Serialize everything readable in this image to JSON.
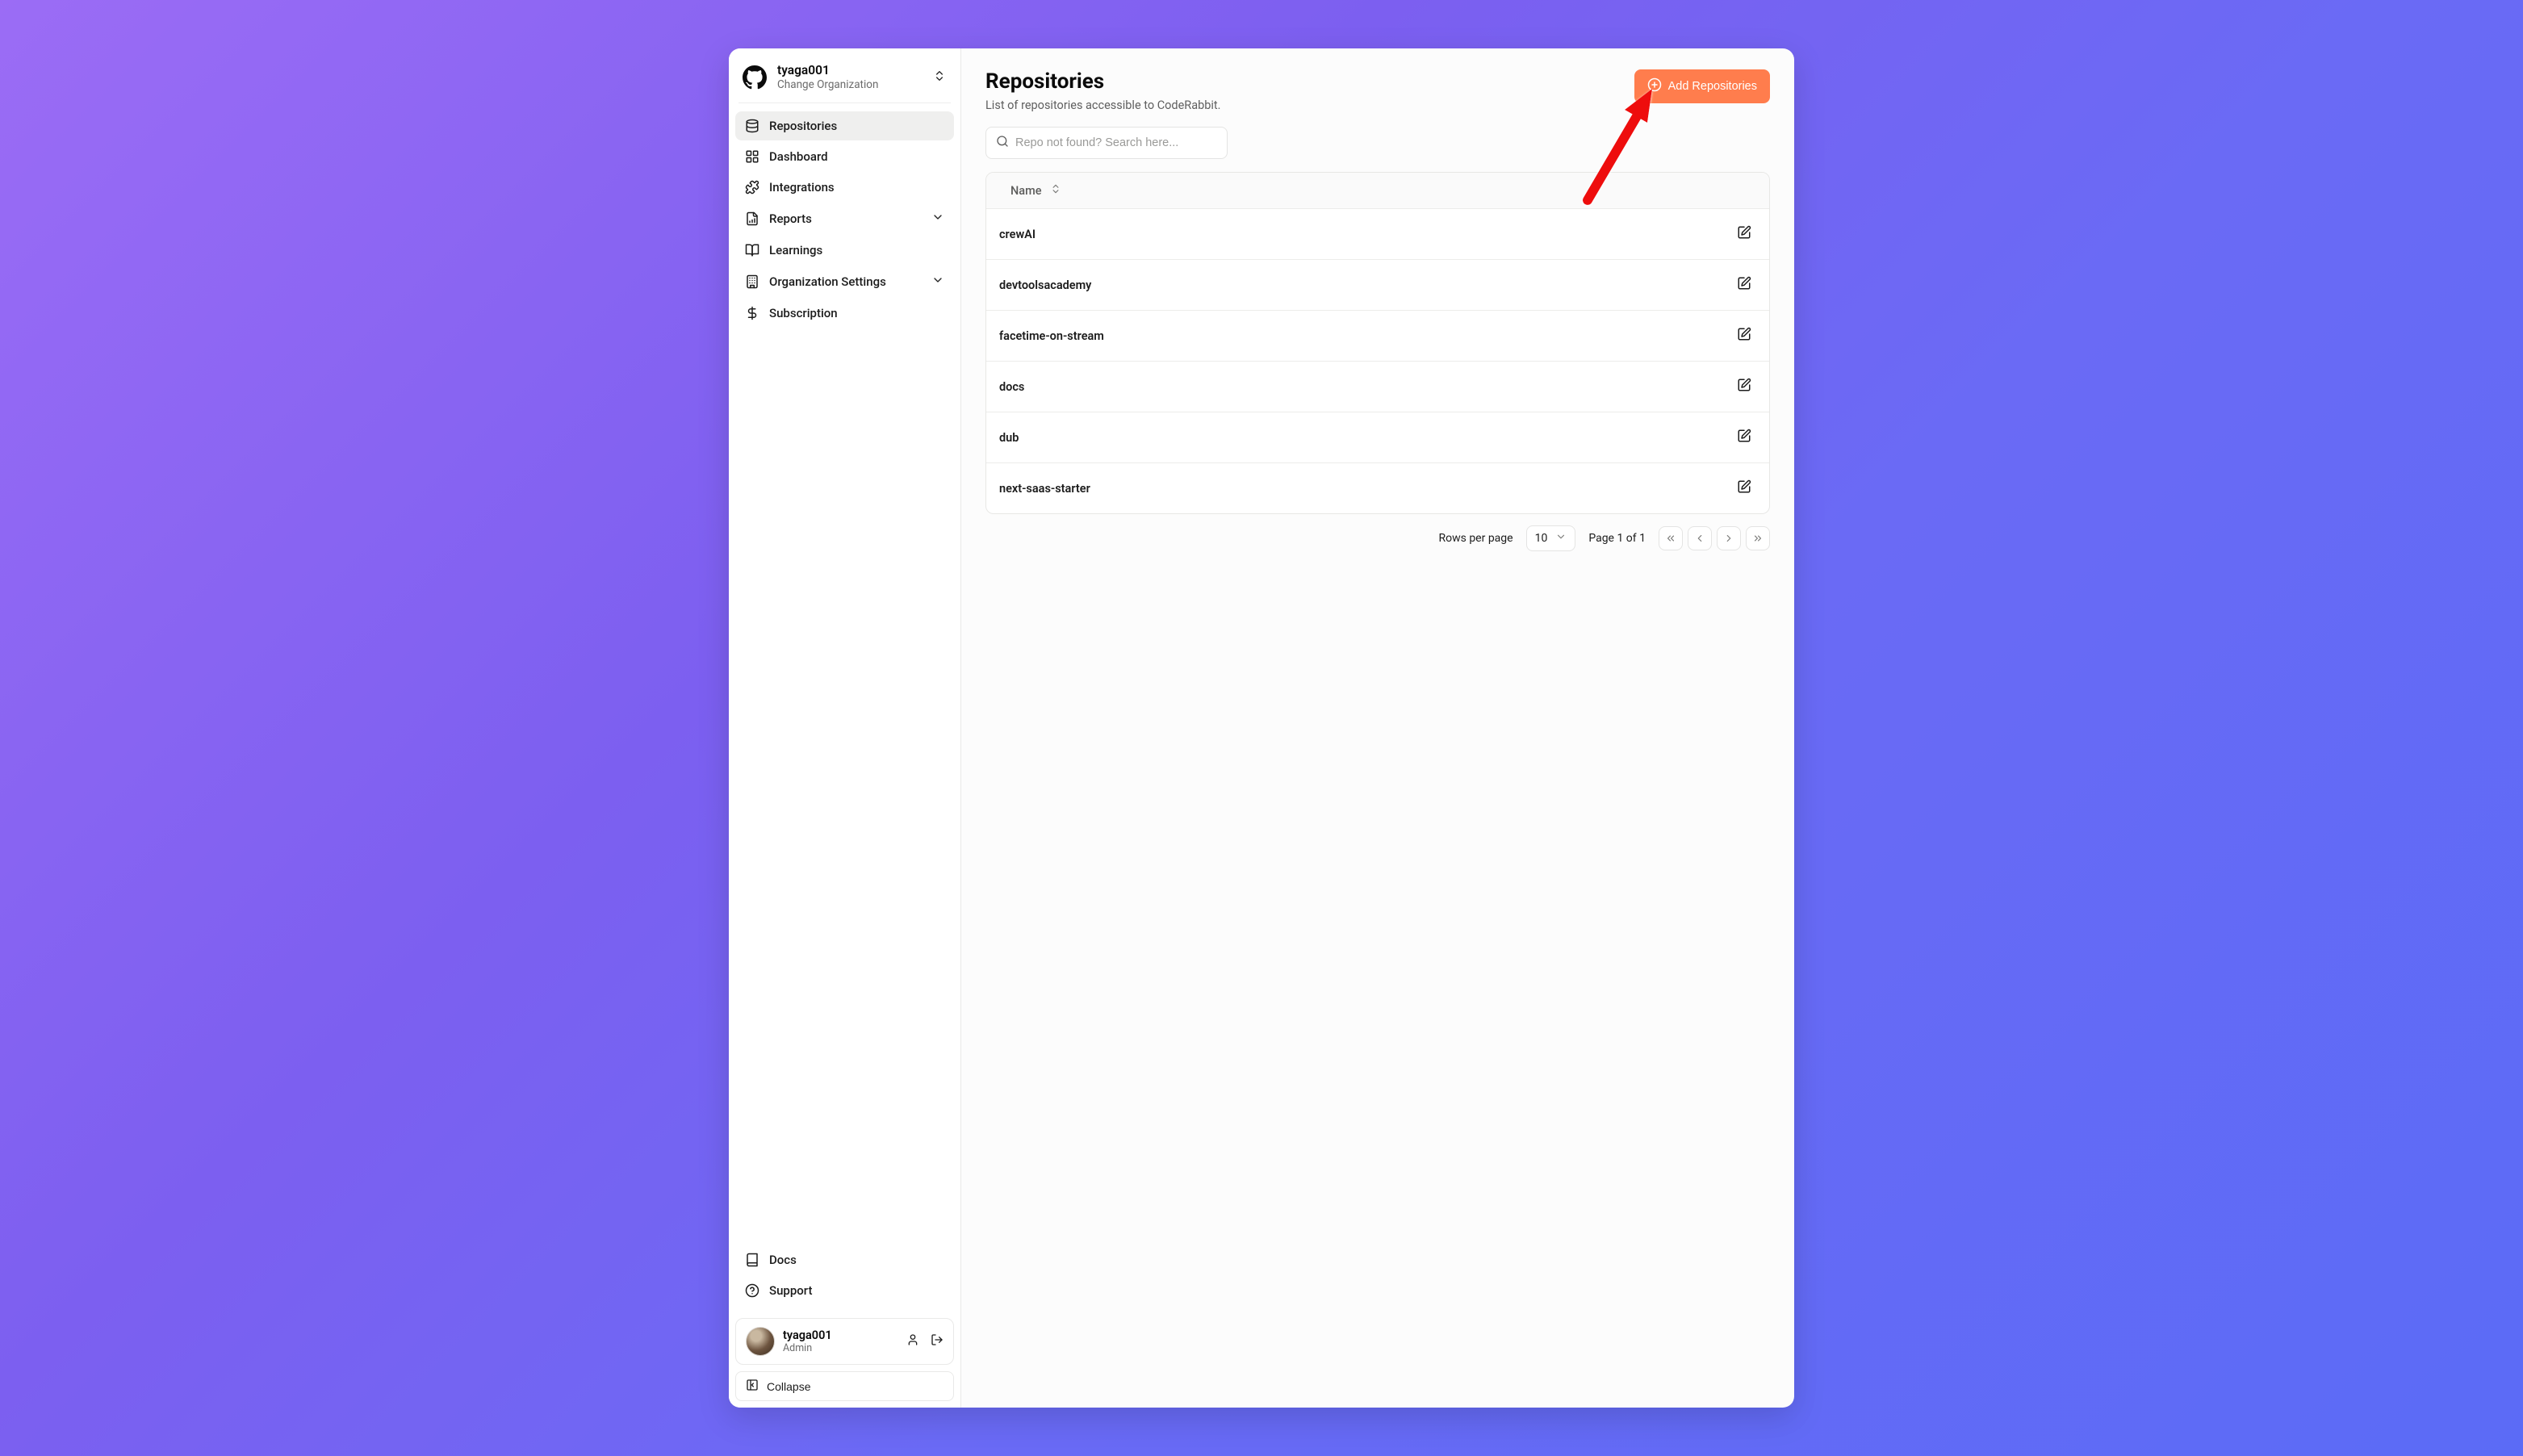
{
  "org": {
    "name": "tyaga001",
    "subtitle": "Change Organization"
  },
  "nav": {
    "repositories": "Repositories",
    "dashboard": "Dashboard",
    "integrations": "Integrations",
    "reports": "Reports",
    "learnings": "Learnings",
    "org_settings": "Organization Settings",
    "subscription": "Subscription"
  },
  "bottom_nav": {
    "docs": "Docs",
    "support": "Support"
  },
  "user": {
    "name": "tyaga001",
    "role": "Admin"
  },
  "collapse_label": "Collapse",
  "page": {
    "title": "Repositories",
    "subtitle": "List of repositories accessible to CodeRabbit.",
    "add_button": "Add Repositories",
    "search_placeholder": "Repo not found? Search here..."
  },
  "table": {
    "header_name": "Name",
    "rows": [
      {
        "name": "crewAI"
      },
      {
        "name": "devtoolsacademy"
      },
      {
        "name": "facetime-on-stream"
      },
      {
        "name": "docs"
      },
      {
        "name": "dub"
      },
      {
        "name": "next-saas-starter"
      }
    ]
  },
  "pager": {
    "rows_label": "Rows per page",
    "rows_value": "10",
    "page_text": "Page 1 of 1"
  }
}
